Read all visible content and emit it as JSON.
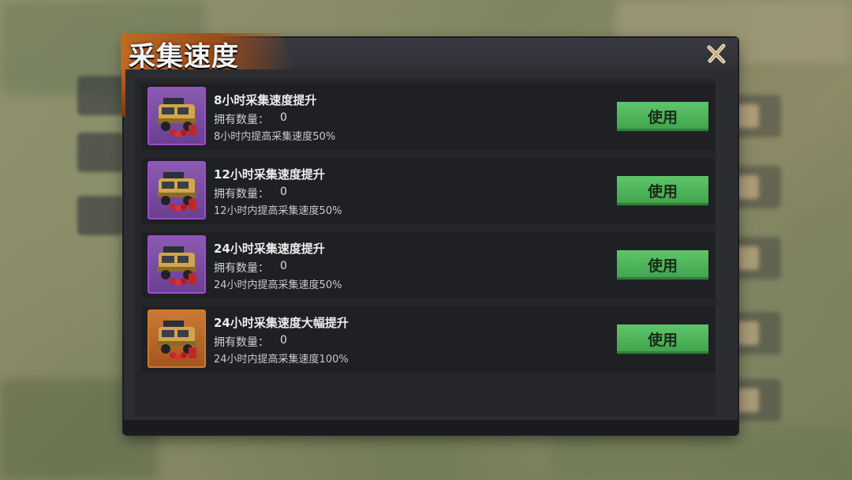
{
  "panel": {
    "title": "采集速度",
    "close_icon": "close-x-icon",
    "accent_color": "#c06a25",
    "button_color": "#4fb45a"
  },
  "items": [
    {
      "name": "8小时采集速度提升",
      "qty_label": "拥有数量：",
      "qty": "0",
      "desc": "8小时内提高采集速度50%",
      "button": "使用",
      "rarity": "purple",
      "icon": "truck-icon"
    },
    {
      "name": "12小时采集速度提升",
      "qty_label": "拥有数量：",
      "qty": "0",
      "desc": "12小时内提高采集速度50%",
      "button": "使用",
      "rarity": "purple",
      "icon": "truck-icon"
    },
    {
      "name": "24小时采集速度提升",
      "qty_label": "拥有数量：",
      "qty": "0",
      "desc": "24小时内提高采集速度50%",
      "button": "使用",
      "rarity": "purple",
      "icon": "truck-icon"
    },
    {
      "name": "24小时采集速度大幅提升",
      "qty_label": "拥有数量：",
      "qty": "0",
      "desc": "24小时内提高采集速度100%",
      "button": "使用",
      "rarity": "orange",
      "icon": "truck-icon"
    }
  ]
}
